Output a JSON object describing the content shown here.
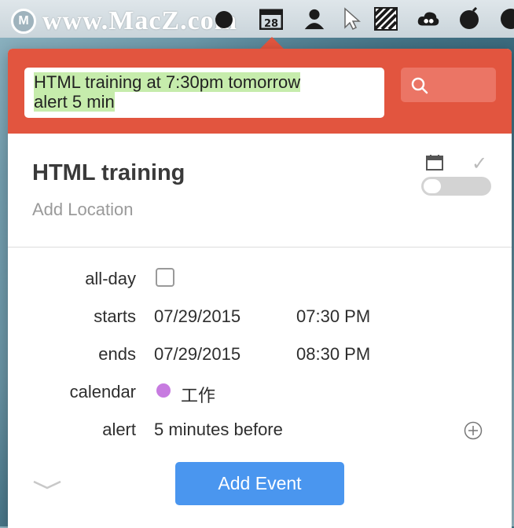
{
  "watermark": {
    "text": "www.MacZ.com",
    "logo": "M"
  },
  "menubar": {
    "icons": [
      "bomb-icon",
      "calendar-icon",
      "user-silhouette-icon",
      "cursor-icon",
      "striped-square-icon",
      "cloud-link-icon",
      "bomb-icon",
      "circle-icon"
    ]
  },
  "input": {
    "line1": "HTML training at 7:30pm tomorrow",
    "line2": "alert 5 min"
  },
  "search": {
    "icon": "search-icon"
  },
  "event": {
    "title": "HTML training",
    "location_placeholder": "Add Location"
  },
  "fields": {
    "allday_label": "all-day",
    "starts_label": "starts",
    "starts_date": "07/29/2015",
    "starts_time": "07:30 PM",
    "ends_label": "ends",
    "ends_date": "07/29/2015",
    "ends_time": "08:30 PM",
    "calendar_label": "calendar",
    "calendar_value": "工作",
    "calendar_color": "#c77be0",
    "alert_label": "alert",
    "alert_value": "5 minutes before"
  },
  "add_button": "Add Event",
  "colors": {
    "accent": "#e2553f",
    "button": "#4a96ef",
    "highlight": "#c6ecac"
  }
}
